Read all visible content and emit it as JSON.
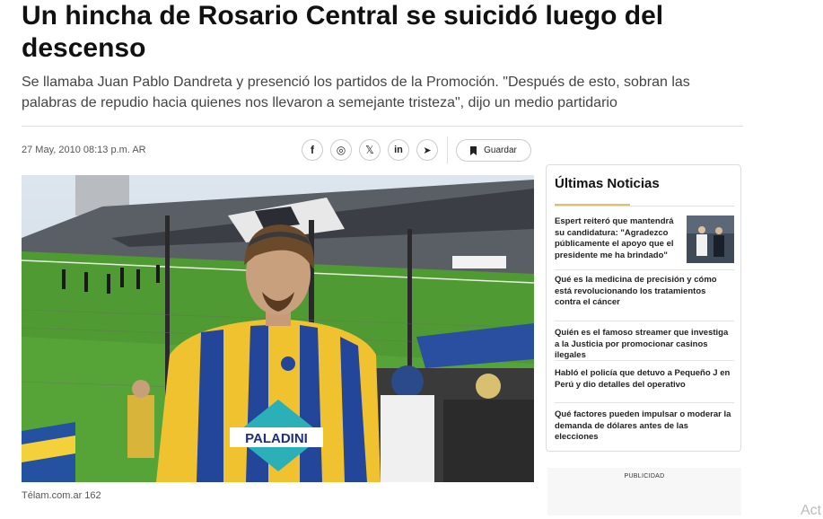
{
  "article": {
    "headline": "Un hincha de Rosario Central se suicidó luego del descenso",
    "subhead": "Se llamaba Juan Pablo Dandreta y presenció los partidos de la Promoción. \"Después de esto, sobran las palabras de repudio hacia quienes nos llevaron a semejante tristeza\", dijo un medio partidario",
    "dateline": "27 May, 2010 08:13 p.m. AR",
    "photo_caption": "Télam.com.ar 162",
    "photo_shirt_text": "PALADINI"
  },
  "share": {
    "icons": [
      "facebook-icon",
      "whatsapp-icon",
      "x-icon",
      "linkedin-icon",
      "telegram-icon"
    ],
    "facebook": "f",
    "whatsapp": "◎",
    "x": "𝕏",
    "linkedin": "in",
    "telegram": "➤",
    "save_label": "Guardar",
    "save_icon": "bookmark-icon"
  },
  "sidebar": {
    "title": "Últimas Noticias",
    "accent_color": "#e0c070",
    "items": [
      {
        "text": "Espert reiteró que mantendrá su candidatura: \"Agradezco públicamente el apoyo que el presidente me ha brindado\""
      },
      {
        "text": "Qué es la medicina de precisión y cómo está revolucionando los tratamientos contra el cáncer"
      },
      {
        "text": "Quién es el famoso streamer que investiga a la Justicia por promocionar casinos ilegales"
      },
      {
        "text": "Habló el policía que detuvo a Pequeño J en Perú y dio detalles del operativo"
      },
      {
        "text": "Qué factores pueden impulsar o moderar la demanda de dólares antes de las elecciones"
      }
    ]
  },
  "ad": {
    "label": "PUBLICIDAD"
  },
  "overlay": {
    "activate_text": "Act"
  }
}
